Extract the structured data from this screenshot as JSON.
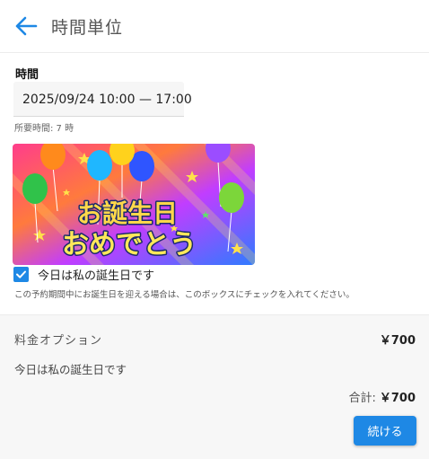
{
  "header": {
    "title": "時間単位",
    "back_icon": "arrow-left-icon"
  },
  "time": {
    "label": "時間",
    "value": "2025/09/24 10:00 — 17:00",
    "duration": "所要時間: 7 時"
  },
  "banner": {
    "line1": "お誕生日",
    "line2": "おめでとう"
  },
  "birthday": {
    "checked": true,
    "label": "今日は私の誕生日です",
    "hint": "この予約期間中にお誕生日を迎える場合は、このボックスにチェックを入れてください。"
  },
  "summary": {
    "option_label": "料金オプション",
    "option_price": "￥700",
    "item": "今日は私の誕生日です",
    "total_label": "合計:",
    "total_value": "￥700",
    "continue_label": "続ける"
  },
  "colors": {
    "accent": "#1e88e5"
  }
}
